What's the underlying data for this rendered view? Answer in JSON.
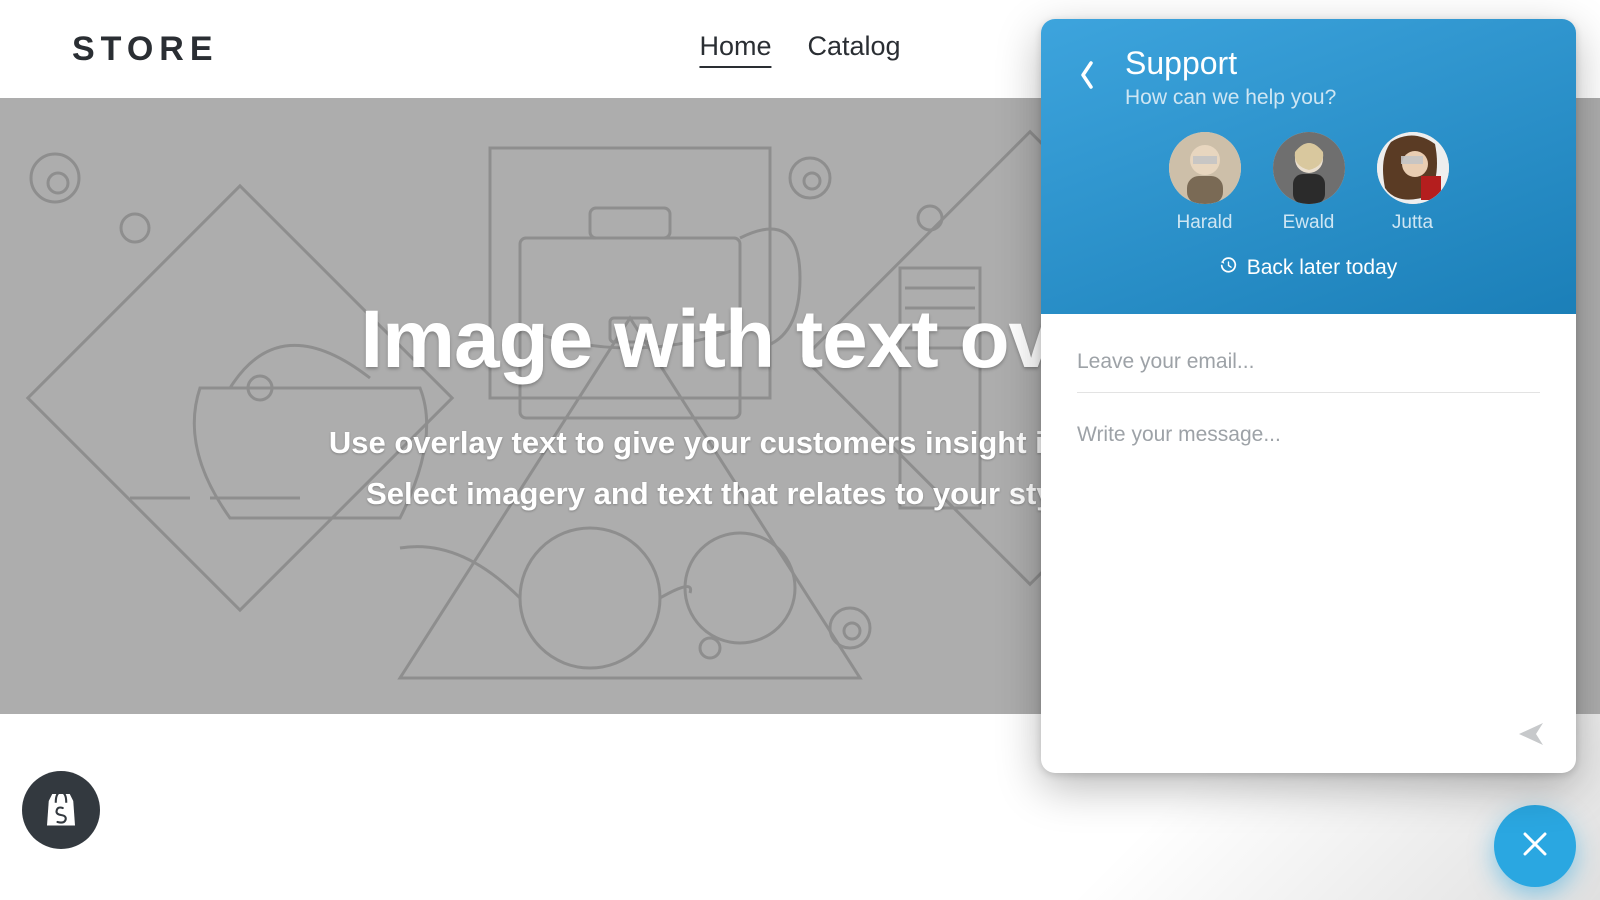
{
  "header": {
    "logo": "STORE",
    "nav": {
      "home": "Home",
      "catalog": "Catalog"
    }
  },
  "hero": {
    "title": "Image with text overlay",
    "sub1": "Use overlay text to give your customers insight into your brand.",
    "sub2": "Select imagery and text that relates to your style and story."
  },
  "chat": {
    "title": "Support",
    "tagline": "How can we help you?",
    "agents": [
      {
        "name": "Harald"
      },
      {
        "name": "Ewald"
      },
      {
        "name": "Jutta"
      }
    ],
    "back_later": "Back later today",
    "email_placeholder": "Leave your email...",
    "message_placeholder": "Write your message..."
  }
}
